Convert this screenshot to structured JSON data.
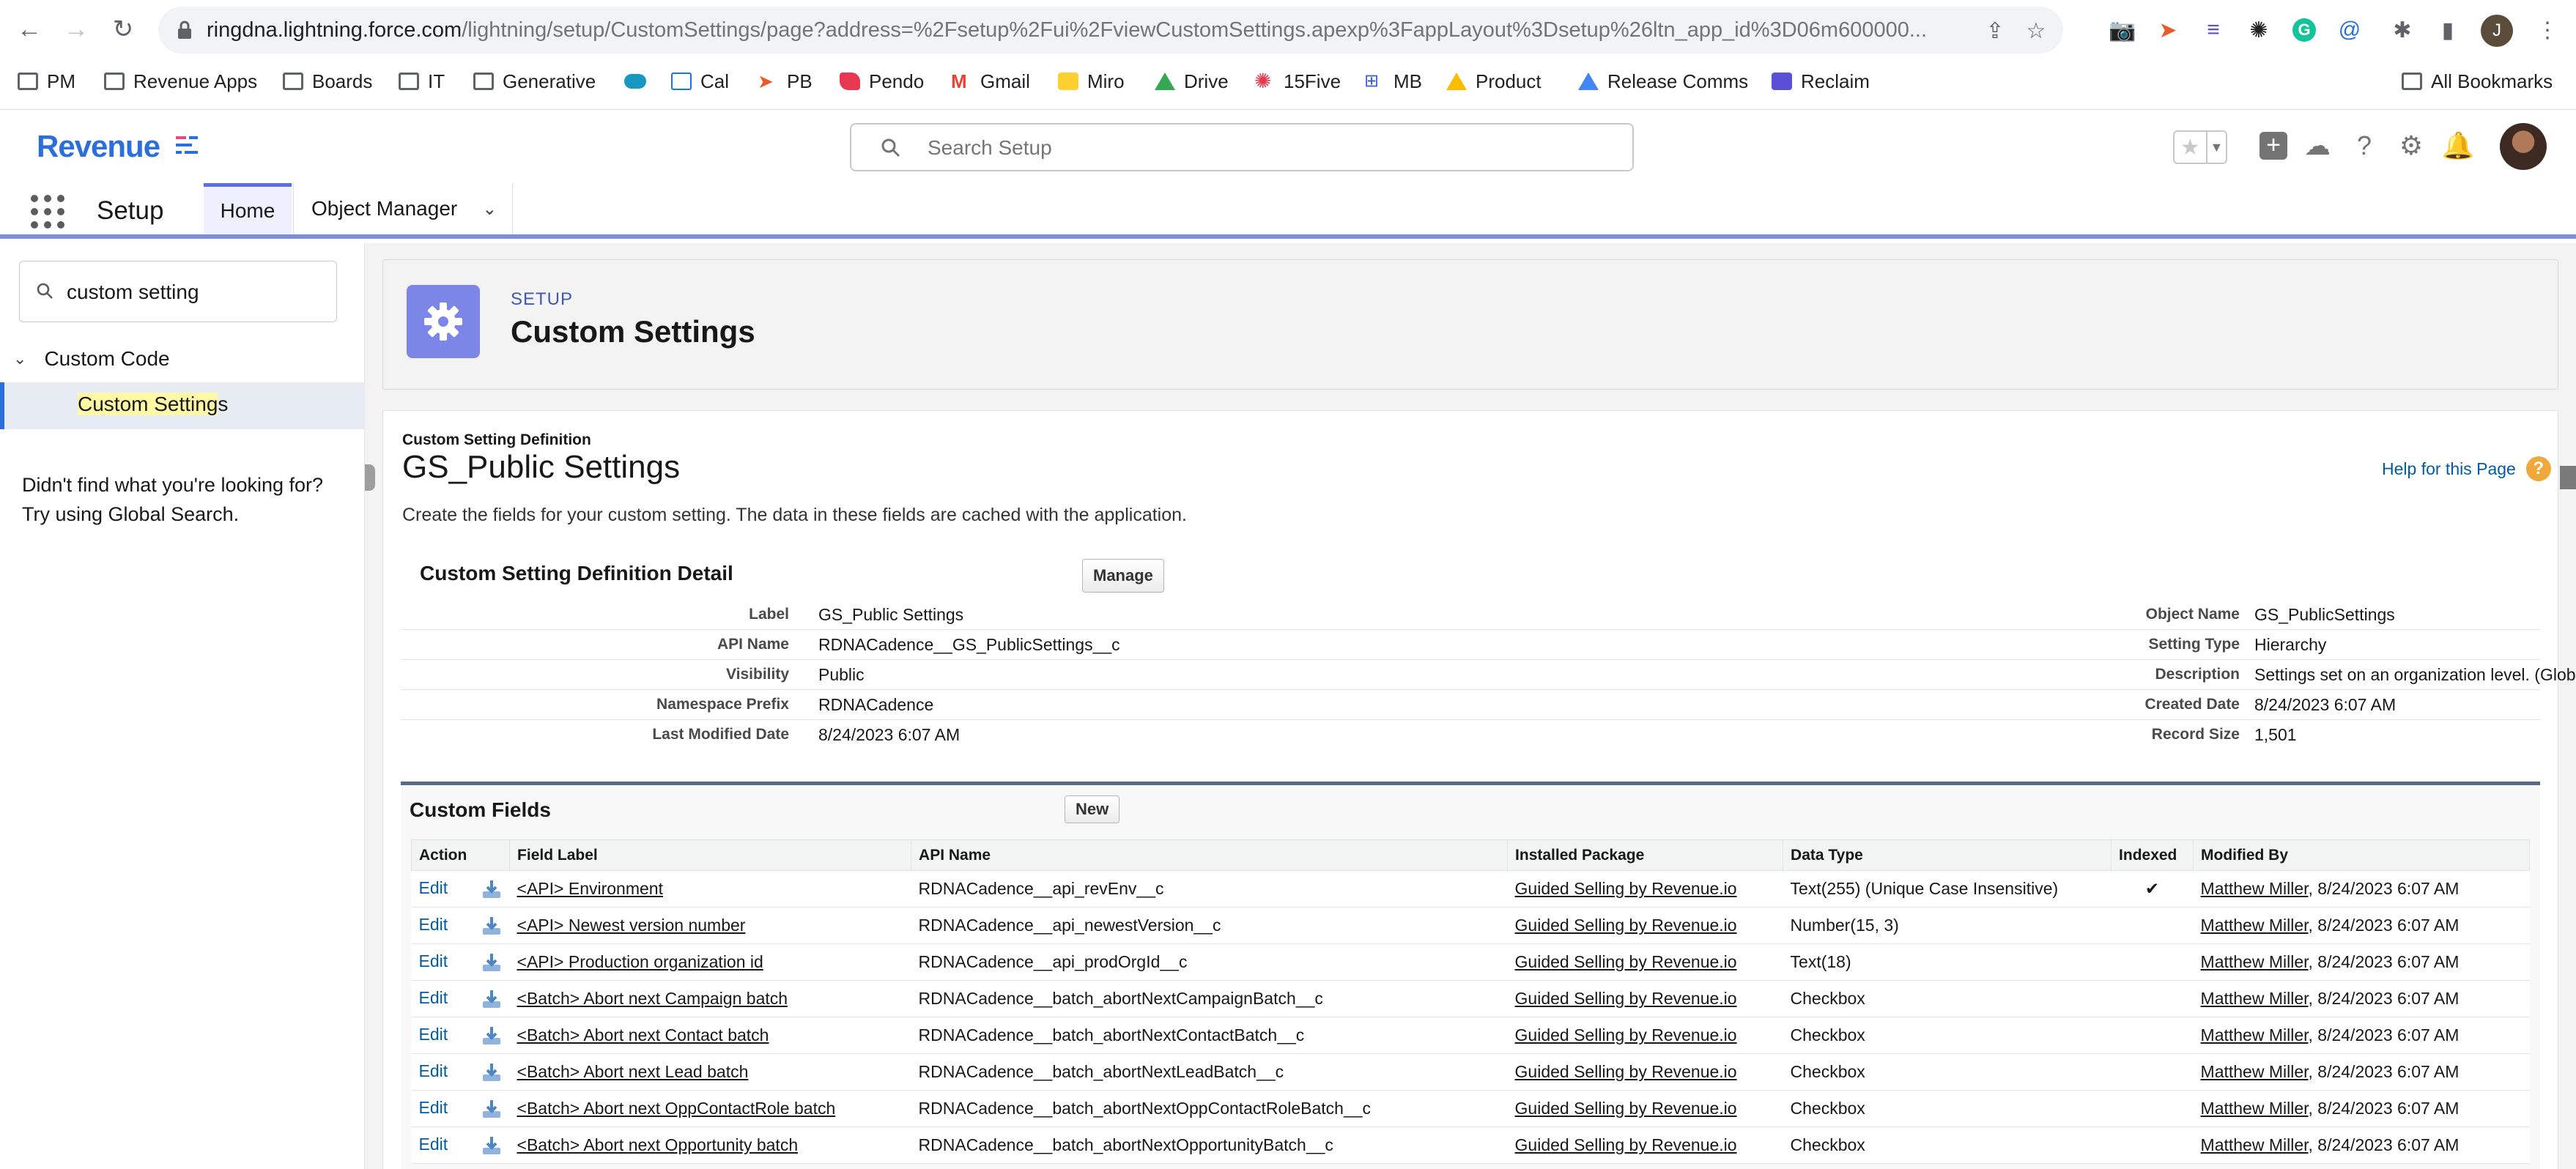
{
  "browser": {
    "url_host": "ringdna.lightning.force.com",
    "url_path": "/lightning/setup/CustomSettings/page?address=%2Fsetup%2Fui%2FviewCustomSettings.apexp%3FappLayout%3Dsetup%26ltn_app_id%3D06m600000...",
    "profile_initial": "J",
    "bookmarks": [
      {
        "label": "PM",
        "icon": "folder-icon"
      },
      {
        "label": "Revenue Apps",
        "icon": "folder-icon"
      },
      {
        "label": "Boards",
        "icon": "folder-icon"
      },
      {
        "label": "IT",
        "icon": "folder-icon"
      },
      {
        "label": "Generative",
        "icon": "folder-icon"
      },
      {
        "label": "",
        "icon": "salesforce-cloud-icon"
      },
      {
        "label": "Cal",
        "icon": "calendar-icon"
      },
      {
        "label": "PB",
        "icon": "pb-icon"
      },
      {
        "label": "Pendo",
        "icon": "pendo-icon"
      },
      {
        "label": "Gmail",
        "icon": "gmail-icon"
      },
      {
        "label": "Miro",
        "icon": "miro-icon"
      },
      {
        "label": "Drive",
        "icon": "drive-icon"
      },
      {
        "label": "15Five",
        "icon": "fifteenfive-icon"
      },
      {
        "label": "MB",
        "icon": "mb-icon"
      },
      {
        "label": "Product",
        "icon": "drive-icon"
      },
      {
        "label": "Release Comms",
        "icon": "drive-icon"
      },
      {
        "label": "Reclaim",
        "icon": "reclaim-icon"
      }
    ],
    "all_bookmarks": "All Bookmarks"
  },
  "sf": {
    "logo_text": "Revenue",
    "search_placeholder": "Search Setup",
    "nav": {
      "app_title": "Setup",
      "tab_home": "Home",
      "tab_object_manager": "Object Manager"
    },
    "sidebar": {
      "quickfind_value": "custom setting",
      "tree_parent": "Custom Code",
      "tree_child_highlight": "Custom Setting",
      "tree_child_rest": "s",
      "not_found": "Didn't find what you're looking for? Try using Global Search."
    },
    "header": {
      "eyebrow": "SETUP",
      "title": "Custom Settings"
    },
    "content": {
      "def_eyebrow": "Custom Setting Definition",
      "def_title": "GS_Public Settings",
      "help_link": "Help for this Page",
      "description": "Create the fields for your custom setting. The data in these fields are cached with the application.",
      "detail_title": "Custom Setting Definition Detail",
      "manage_label": "Manage",
      "detail_rows": [
        {
          "l_label": "Label",
          "l_value": "GS_Public Settings",
          "r_label": "Object Name",
          "r_value": "GS_PublicSettings"
        },
        {
          "l_label": "API Name",
          "l_value": "RDNACadence__GS_PublicSettings__c",
          "r_label": "Setting Type",
          "r_value": "Hierarchy"
        },
        {
          "l_label": "Visibility",
          "l_value": "Public",
          "r_label": "Description",
          "r_value": "Settings set on an organization level. (Global settings)"
        },
        {
          "l_label": "Namespace Prefix",
          "l_value": "RDNACadence",
          "r_label": "Created Date",
          "r_value": "8/24/2023 6:07 AM"
        },
        {
          "l_label": "Last Modified Date",
          "l_value": "8/24/2023 6:07 AM",
          "r_label": "Record Size",
          "r_value": "1,501"
        }
      ],
      "fields_title": "Custom Fields",
      "new_label": "New",
      "columns": [
        "Action",
        "Field Label",
        "API Name",
        "Installed Package",
        "Data Type",
        "Indexed",
        "Modified By"
      ],
      "rows": [
        {
          "action": "Edit",
          "label": "<API> Environment",
          "api": "RDNACadence__api_revEnv__c",
          "package": "Guided Selling by Revenue.io",
          "type": "Text(255) (Unique Case Insensitive)",
          "indexed": "✔",
          "user": "Matthew Miller",
          "date": ", 8/24/2023 6:07 AM"
        },
        {
          "action": "Edit",
          "label": "<API> Newest version number",
          "api": "RDNACadence__api_newestVersion__c",
          "package": "Guided Selling by Revenue.io",
          "type": "Number(15, 3)",
          "indexed": "",
          "user": "Matthew Miller",
          "date": ", 8/24/2023 6:07 AM"
        },
        {
          "action": "Edit",
          "label": "<API> Production organization id",
          "api": "RDNACadence__api_prodOrgId__c",
          "package": "Guided Selling by Revenue.io",
          "type": "Text(18)",
          "indexed": "",
          "user": "Matthew Miller",
          "date": ", 8/24/2023 6:07 AM"
        },
        {
          "action": "Edit",
          "label": "<Batch> Abort next Campaign batch",
          "api": "RDNACadence__batch_abortNextCampaignBatch__c",
          "package": "Guided Selling by Revenue.io",
          "type": "Checkbox",
          "indexed": "",
          "user": "Matthew Miller",
          "date": ", 8/24/2023 6:07 AM"
        },
        {
          "action": "Edit",
          "label": "<Batch> Abort next Contact batch",
          "api": "RDNACadence__batch_abortNextContactBatch__c",
          "package": "Guided Selling by Revenue.io",
          "type": "Checkbox",
          "indexed": "",
          "user": "Matthew Miller",
          "date": ", 8/24/2023 6:07 AM"
        },
        {
          "action": "Edit",
          "label": "<Batch> Abort next Lead batch",
          "api": "RDNACadence__batch_abortNextLeadBatch__c",
          "package": "Guided Selling by Revenue.io",
          "type": "Checkbox",
          "indexed": "",
          "user": "Matthew Miller",
          "date": ", 8/24/2023 6:07 AM"
        },
        {
          "action": "Edit",
          "label": "<Batch> Abort next OppContactRole batch",
          "api": "RDNACadence__batch_abortNextOppContactRoleBatch__c",
          "package": "Guided Selling by Revenue.io",
          "type": "Checkbox",
          "indexed": "",
          "user": "Matthew Miller",
          "date": ", 8/24/2023 6:07 AM"
        },
        {
          "action": "Edit",
          "label": "<Batch> Abort next Opportunity batch",
          "api": "RDNACadence__batch_abortNextOpportunityBatch__c",
          "package": "Guided Selling by Revenue.io",
          "type": "Checkbox",
          "indexed": "",
          "user": "Matthew Miller",
          "date": ", 8/24/2023 6:07 AM"
        }
      ]
    }
  }
}
